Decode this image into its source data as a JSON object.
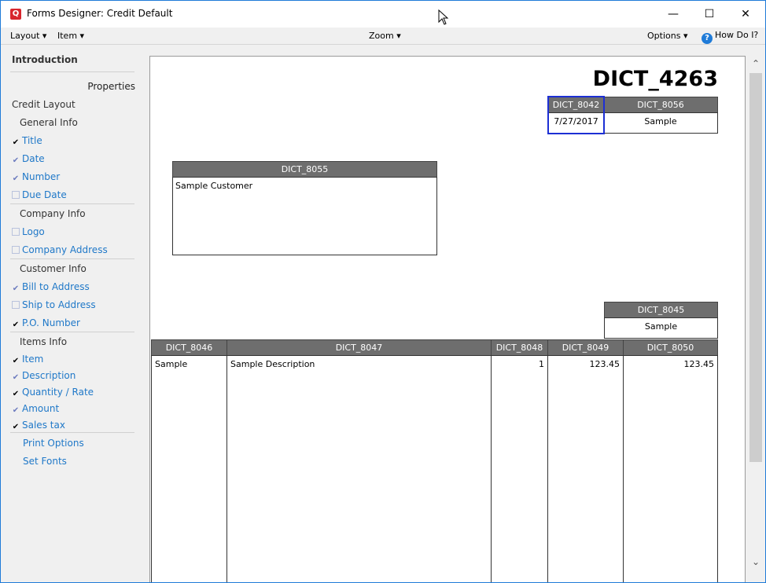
{
  "window": {
    "app_icon": "Q",
    "title": "Forms Designer:  Credit Default",
    "minimize": "—",
    "maximize": "☐",
    "close": "✕"
  },
  "menubar": {
    "layout": "Layout ▾",
    "item": "Item ▾",
    "zoom": "Zoom ▾",
    "options": "Options ▾",
    "help": "How Do I?"
  },
  "sidebar": {
    "header": "Introduction",
    "properties": "Properties",
    "credit_layout": "Credit Layout",
    "groups": {
      "general": "General Info",
      "company": "Company Info",
      "customer": "Customer Info",
      "items": "Items Info"
    },
    "items": [
      {
        "label": "Title",
        "state": "on"
      },
      {
        "label": "Date",
        "state": "grey"
      },
      {
        "label": "Number",
        "state": "grey"
      },
      {
        "label": "Due Date",
        "state": "off"
      },
      {
        "label": "Logo",
        "state": "off"
      },
      {
        "label": "Company Address",
        "state": "off"
      },
      {
        "label": "Bill to Address",
        "state": "grey"
      },
      {
        "label": "Ship to Address",
        "state": "off"
      },
      {
        "label": "P.O. Number",
        "state": "on"
      },
      {
        "label": "Item",
        "state": "on"
      },
      {
        "label": "Description",
        "state": "grey"
      },
      {
        "label": "Quantity / Rate",
        "state": "on"
      },
      {
        "label": "Amount",
        "state": "grey"
      },
      {
        "label": "Sales tax",
        "state": "on"
      }
    ],
    "print_options": "Print Options",
    "set_fonts": "Set Fonts"
  },
  "document": {
    "title": "DICT_4263",
    "date_header": "DICT_8042",
    "date_value": "7/27/2017",
    "number_header": "DICT_8056",
    "number_value": "Sample",
    "bill_header": "DICT_8055",
    "bill_value": "Sample Customer",
    "po_header": "DICT_8045",
    "po_value": "Sample",
    "columns": [
      "DICT_8046",
      "DICT_8047",
      "DICT_8048",
      "DICT_8049",
      "DICT_8050"
    ],
    "row": [
      "Sample",
      "Sample Description",
      "1",
      "123.45",
      "123.45"
    ]
  },
  "colors": {
    "accent": "#1f78c8",
    "header_bg": "#6e6e6e",
    "selection": "#1d2fd4"
  }
}
